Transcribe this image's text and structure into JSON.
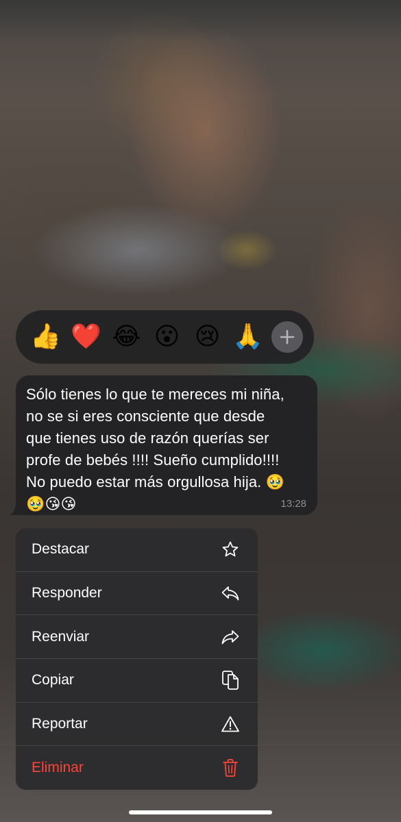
{
  "reactions": [
    {
      "emoji": "👍",
      "name": "thumbs-up"
    },
    {
      "emoji": "❤️",
      "name": "red-heart"
    },
    {
      "emoji": "😂",
      "name": "tears-of-joy"
    },
    {
      "emoji": "😮",
      "name": "open-mouth"
    },
    {
      "emoji": "😢",
      "name": "crying"
    },
    {
      "emoji": "🙏",
      "name": "folded-hands"
    }
  ],
  "reaction_more_icon": "plus-icon",
  "message": {
    "text": "Sólo tienes lo que te mereces mi niña,\nno se si eres consciente que desde\nque tienes uso de razón querías ser\nprofe de bebés !!!! Sueño cumplido!!!!\nNo puedo estar más orgullosa hija. 🥹\n🥹😘😘",
    "time": "13:28"
  },
  "menu": [
    {
      "label": "Destacar",
      "icon": "star-icon"
    },
    {
      "label": "Responder",
      "icon": "reply-icon"
    },
    {
      "label": "Reenviar",
      "icon": "forward-icon"
    },
    {
      "label": "Copiar",
      "icon": "copy-icon"
    },
    {
      "label": "Reportar",
      "icon": "warning-icon"
    },
    {
      "label": "Eliminar",
      "icon": "trash-icon",
      "destructive": true
    }
  ],
  "colors": {
    "destructive": "#ff453a",
    "bubble": "#232325",
    "menu_bg": "#2c2c2e",
    "timestamp": "#8e8e93"
  }
}
